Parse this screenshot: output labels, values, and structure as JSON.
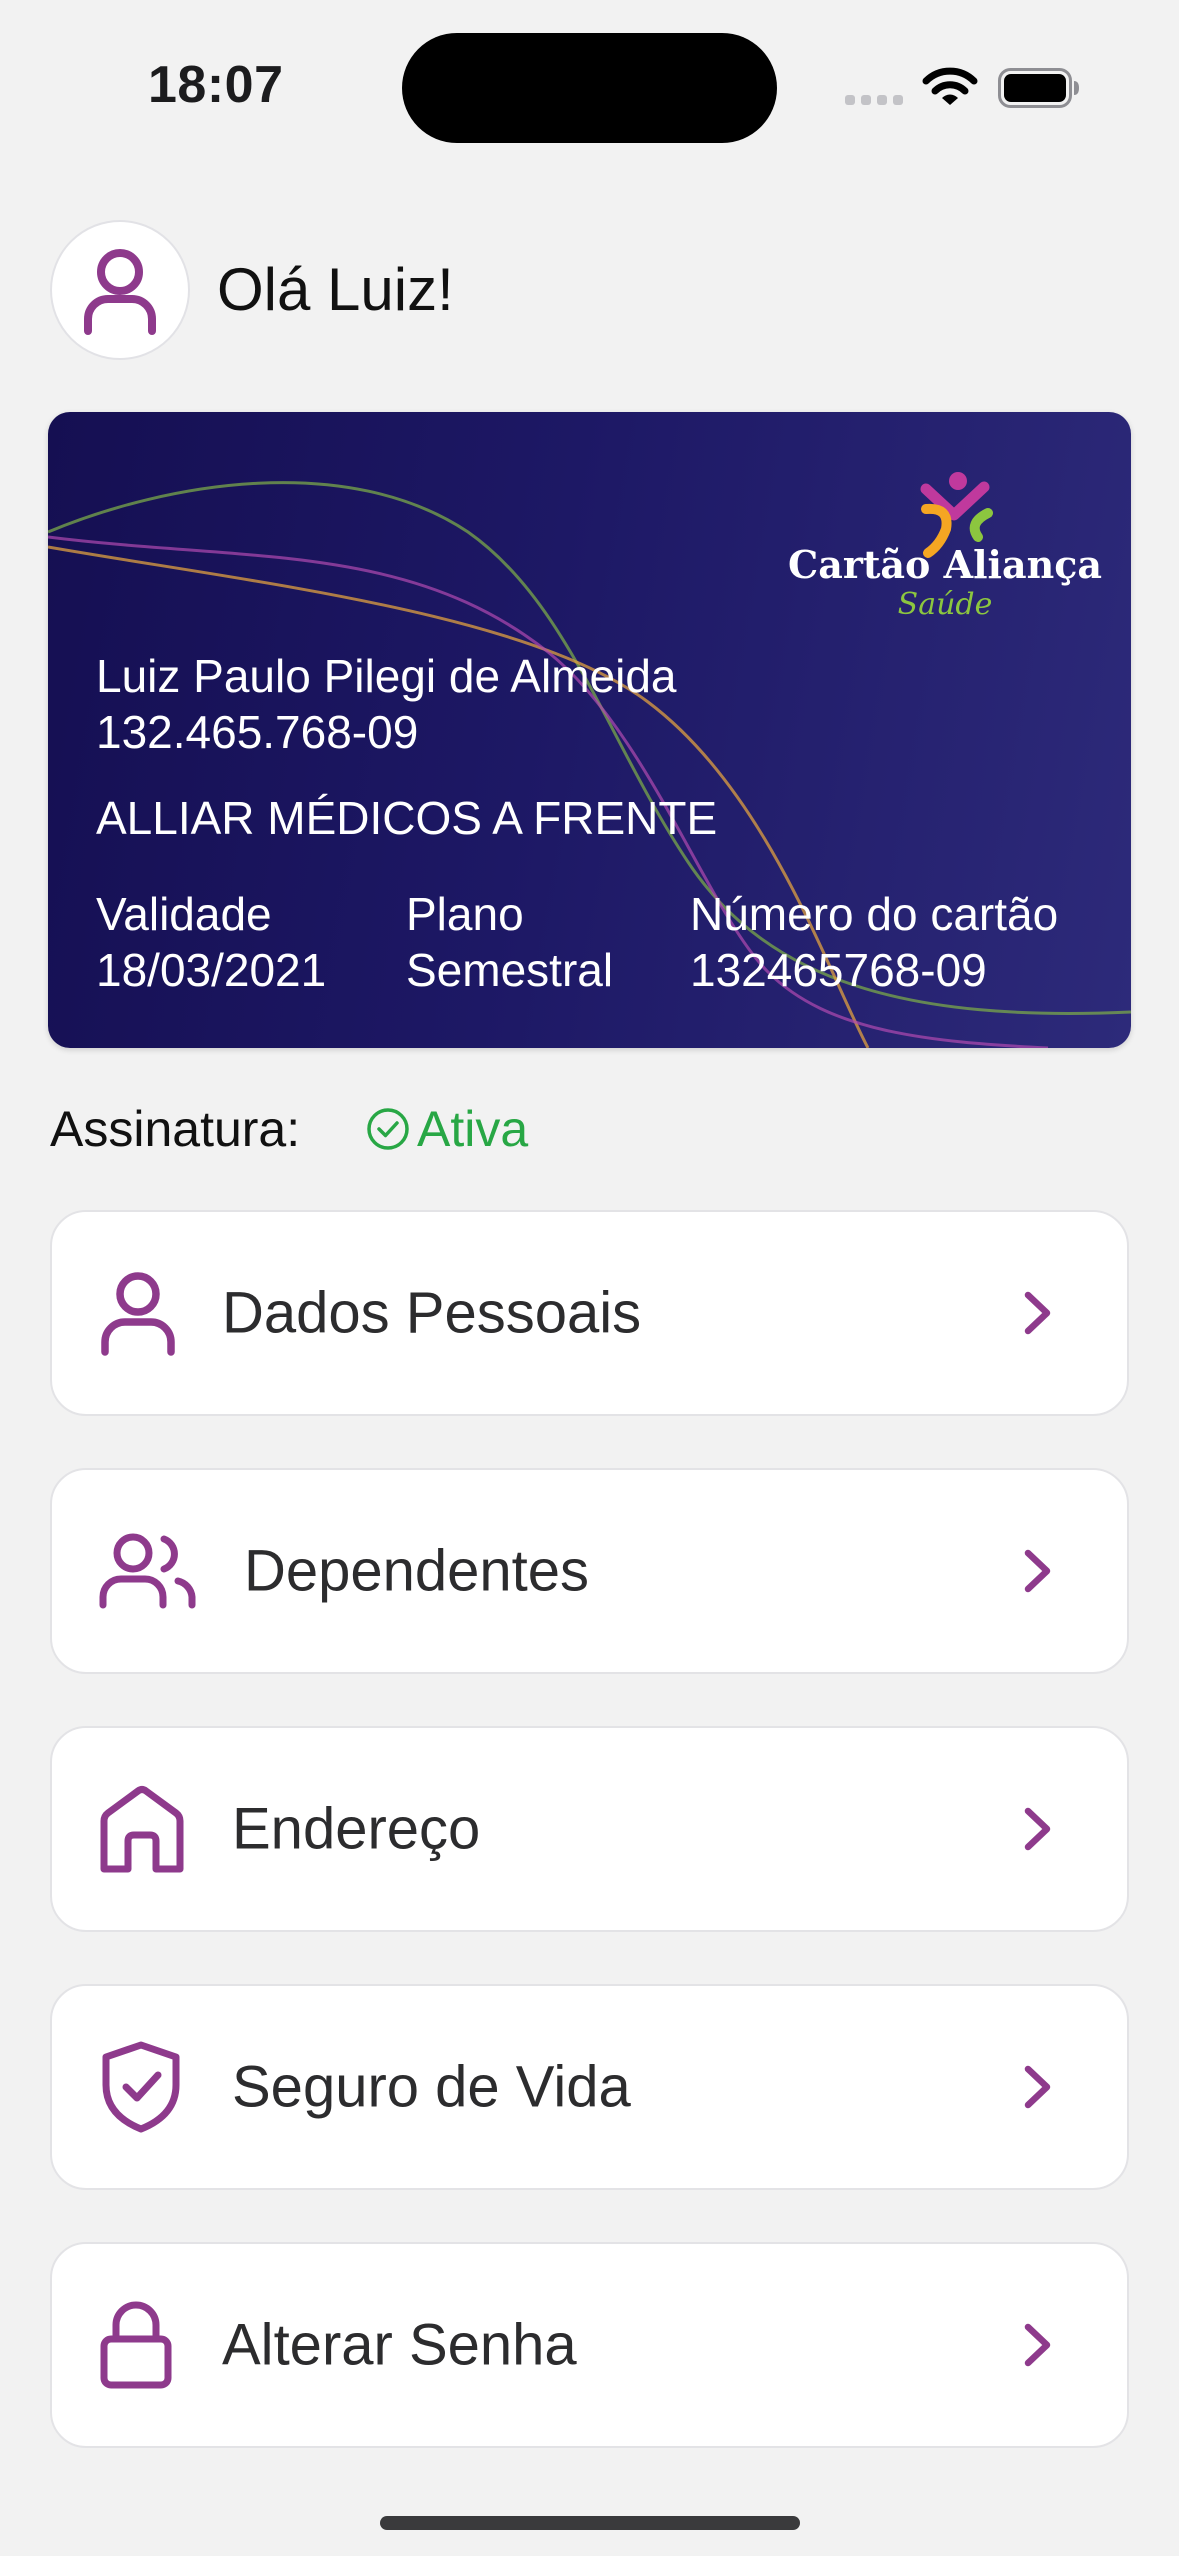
{
  "status_bar": {
    "time": "18:07"
  },
  "header": {
    "greeting": "Olá Luiz!",
    "avatar_icon": "user-icon"
  },
  "card": {
    "brand_name": "Cartão Aliança",
    "brand_sub": "Saúde",
    "holder_name": "Luiz Paulo Pilegi de Almeida",
    "holder_document": "132.465.768-09",
    "company": "ALLIAR MÉDICOS A FRENTE",
    "validity_label": "Validade",
    "validity_value": "18/03/2021",
    "plan_label": "Plano",
    "plan_value": "Semestral",
    "card_number_label": "Número do cartão",
    "card_number_value": "132465768-09"
  },
  "subscription": {
    "label": "Assinatura:",
    "status": "Ativa",
    "status_color": "#28a745"
  },
  "menu": {
    "items": [
      {
        "label": "Dados Pessoais",
        "icon": "user-icon"
      },
      {
        "label": "Dependentes",
        "icon": "users-icon"
      },
      {
        "label": "Endereço",
        "icon": "home-icon"
      },
      {
        "label": "Seguro de Vida",
        "icon": "shield-check-icon"
      },
      {
        "label": "Alterar Senha",
        "icon": "lock-icon"
      }
    ]
  },
  "colors": {
    "accent": "#8e3a8c",
    "card_background": "#1d1865",
    "success": "#28a745"
  }
}
